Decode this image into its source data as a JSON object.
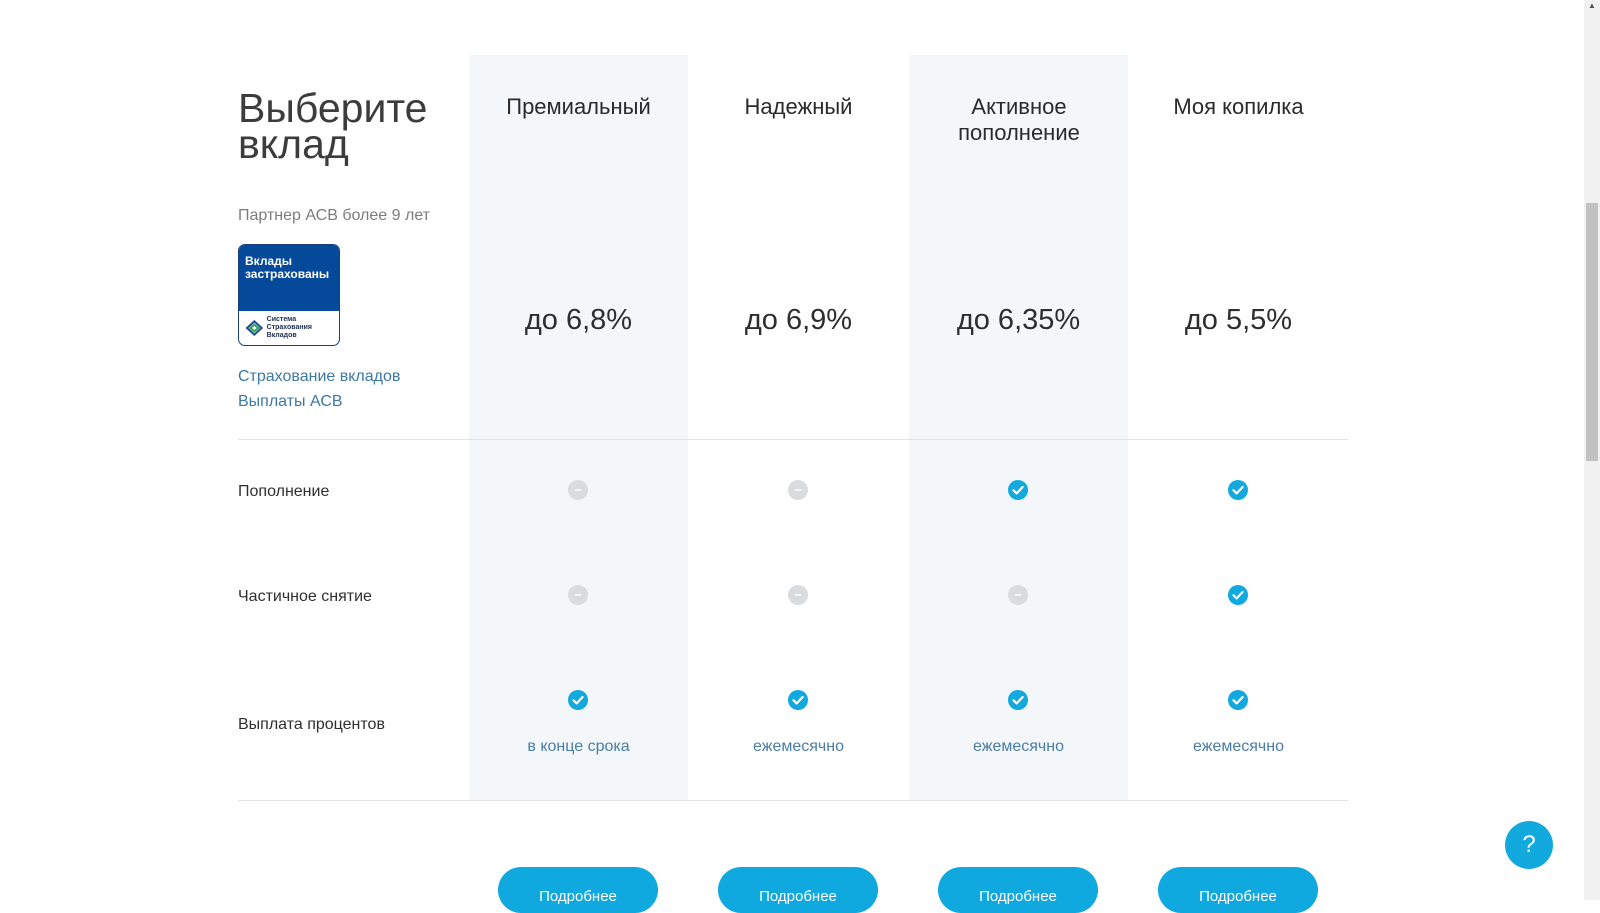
{
  "page": {
    "title": "Выберите вклад",
    "partner": "Партнер АСВ более 9 лет"
  },
  "badge": {
    "title": "Вклады застрахованы",
    "org": "Система Страхования Вкладов"
  },
  "links": {
    "insurance": "Страхование вкладов",
    "payouts": "Выплаты АСВ"
  },
  "rows": {
    "replenish": "Пополнение",
    "withdraw": "Частичное снятие",
    "interest": "Выплата процентов"
  },
  "columns": [
    {
      "title": "Премиальный",
      "rate": "до 6,8%",
      "replenish": false,
      "withdraw": false,
      "interest": true,
      "payout": "в конце срока",
      "button": "Подробнее"
    },
    {
      "title": "Надежный",
      "rate": "до 6,9%",
      "replenish": false,
      "withdraw": false,
      "interest": true,
      "payout": "ежемесячно",
      "button": "Подробнее"
    },
    {
      "title": "Активное пополнение",
      "rate": "до 6,35%",
      "replenish": true,
      "withdraw": false,
      "interest": true,
      "payout": "ежемесячно",
      "button": "Подробнее"
    },
    {
      "title": "Моя копилка",
      "rate": "до 5,5%",
      "replenish": true,
      "withdraw": true,
      "interest": true,
      "payout": "ежемесячно",
      "button": "Подробнее"
    }
  ],
  "help": {
    "label": "?"
  },
  "icons": {
    "yes": "check-circle-icon",
    "no": "dash-circle-icon",
    "help": "question-icon"
  },
  "colors": {
    "accent": "#0fa8df",
    "link": "#3d78a6",
    "column_shade": "#f4f7f9",
    "badge_blue": "#05499a"
  }
}
